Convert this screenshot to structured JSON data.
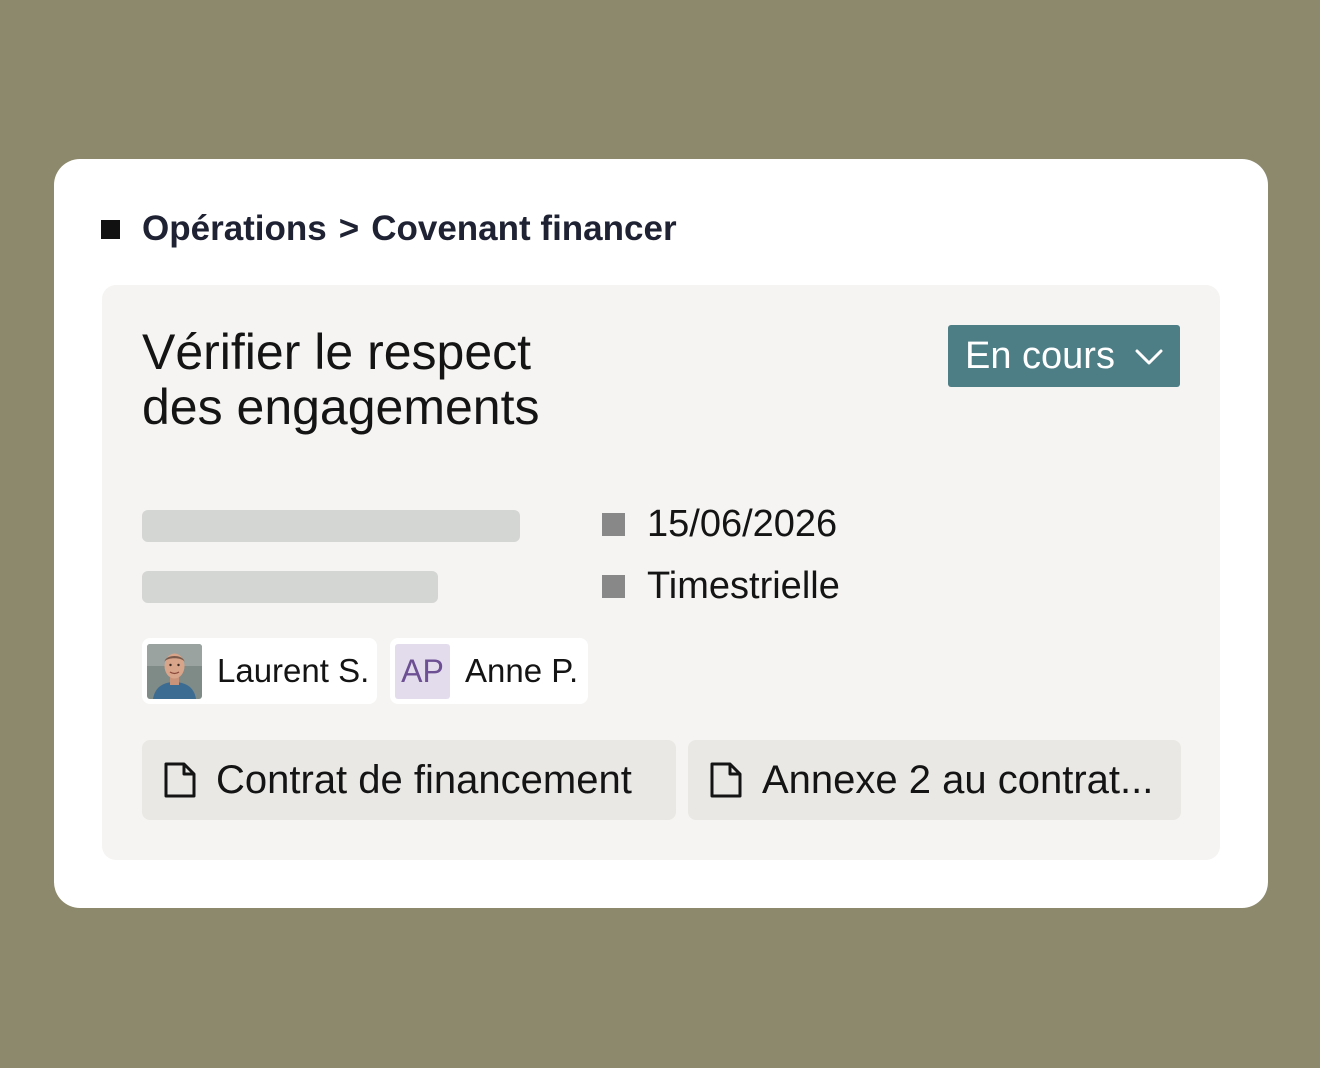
{
  "breadcrumb": {
    "parent": "Opérations",
    "separator": ">",
    "current": "Covenant financer"
  },
  "task": {
    "title_line1": "Vérifier le respect",
    "title_line2": "des engagements",
    "status": "En cours",
    "due_date": "15/06/2026",
    "frequency": "Timestrielle"
  },
  "assignees": [
    {
      "name": "Laurent S.",
      "avatar": "photo"
    },
    {
      "name": "Anne P.",
      "initials": "AP"
    }
  ],
  "documents": [
    {
      "label": "Contrat de financement",
      "icon": "file-icon"
    },
    {
      "label": "Annexe 2 au contrat...",
      "icon": "file-icon"
    }
  ],
  "colors": {
    "background": "#8d896c",
    "status_bg": "#4d7e86",
    "initials_bg": "#e3dced",
    "initials_fg": "#6d4f93"
  }
}
